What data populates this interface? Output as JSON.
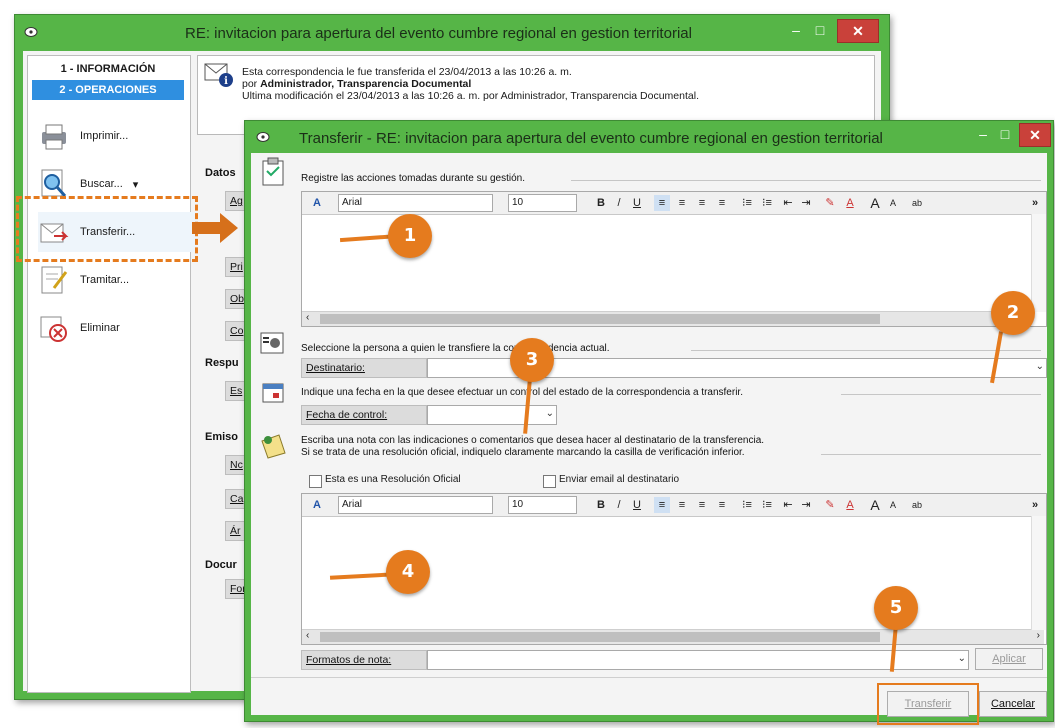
{
  "main_window": {
    "title": "RE: invitacion para apertura del evento cumbre regional en gestion territorial",
    "controls": {
      "minimize": "–",
      "maximize": "□",
      "close": "✕"
    },
    "sidebar": {
      "tabs": [
        "1 - INFORMACIÓN",
        "2 - OPERACIONES"
      ],
      "items": [
        {
          "label": "Imprimir...",
          "icon": "printer-icon"
        },
        {
          "label": "Buscar...",
          "icon": "search-icon",
          "arrow": "▾"
        },
        {
          "label": "Transferir...",
          "icon": "transfer-icon"
        },
        {
          "label": "Tramitar...",
          "icon": "process-icon"
        },
        {
          "label": "Eliminar",
          "icon": "delete-icon"
        }
      ]
    },
    "info": {
      "line1": "Esta correspondencia le fue transferida el 23/04/2013 a las 10:26 a. m.",
      "line2_prefix": "por ",
      "line2_bold": "Administrador, Transparencia Documental",
      "line3": "Ultima modificación el 23/04/2013 a las 10:26 a. m. por Administrador, Transparencia Documental."
    },
    "partial_sections": [
      "Datos",
      "Respu",
      "Emiso",
      "Docur"
    ],
    "partial_fields": [
      "Ag",
      "Pri",
      "Ob",
      "Co",
      "Es",
      "Nc",
      "Ca",
      "Ár",
      "For"
    ]
  },
  "transfer_dialog": {
    "title": "Transferir  -  RE: invitacion para apertura del evento cumbre regional en gestion territorial",
    "actions_section": "Registre las acciones tomadas durante su gestión.",
    "editor_toolbar": {
      "font": "Arial",
      "size": "10",
      "buttons": [
        "A",
        "B",
        "/",
        "U",
        "≡",
        "≡",
        "≡",
        "≡",
        "⁝≡",
        "⁝≡",
        "⇤",
        "⇥",
        "✎",
        "A",
        "A",
        "A",
        "ab",
        "»"
      ]
    },
    "recipient_section": "Seleccione la persona a quien le transfiere la correspondencia actual.",
    "recipient_label": "Destinatario:",
    "recipient_value": "",
    "date_section": "Indique una fecha en la que desee efectuar un control del estado de la correspondencia a transferir.",
    "date_label": "Fecha de control:",
    "date_value": "",
    "note_section_line1": "Escriba una nota con las indicaciones o comentarios que desea hacer al destinatario de la transferencia.",
    "note_section_line2": "Si se trata de una resolución oficial, indiquelo claramente marcando la casilla de verificación inferior.",
    "checkbox_official": "Esta es una Resolución Oficial",
    "checkbox_email": "Enviar email al destinatario",
    "note_format_label": "Formatos de nota:",
    "apply_button": "Aplicar",
    "transfer_button": "Transferir",
    "cancel_button": "Cancelar"
  },
  "callouts": [
    "1",
    "2",
    "3",
    "4",
    "5"
  ],
  "colors": {
    "window_frame": "#56b547",
    "callout": "#e57b1e",
    "dashed_highlight": "#e57b1e",
    "tab_active": "#2f8fe0"
  }
}
